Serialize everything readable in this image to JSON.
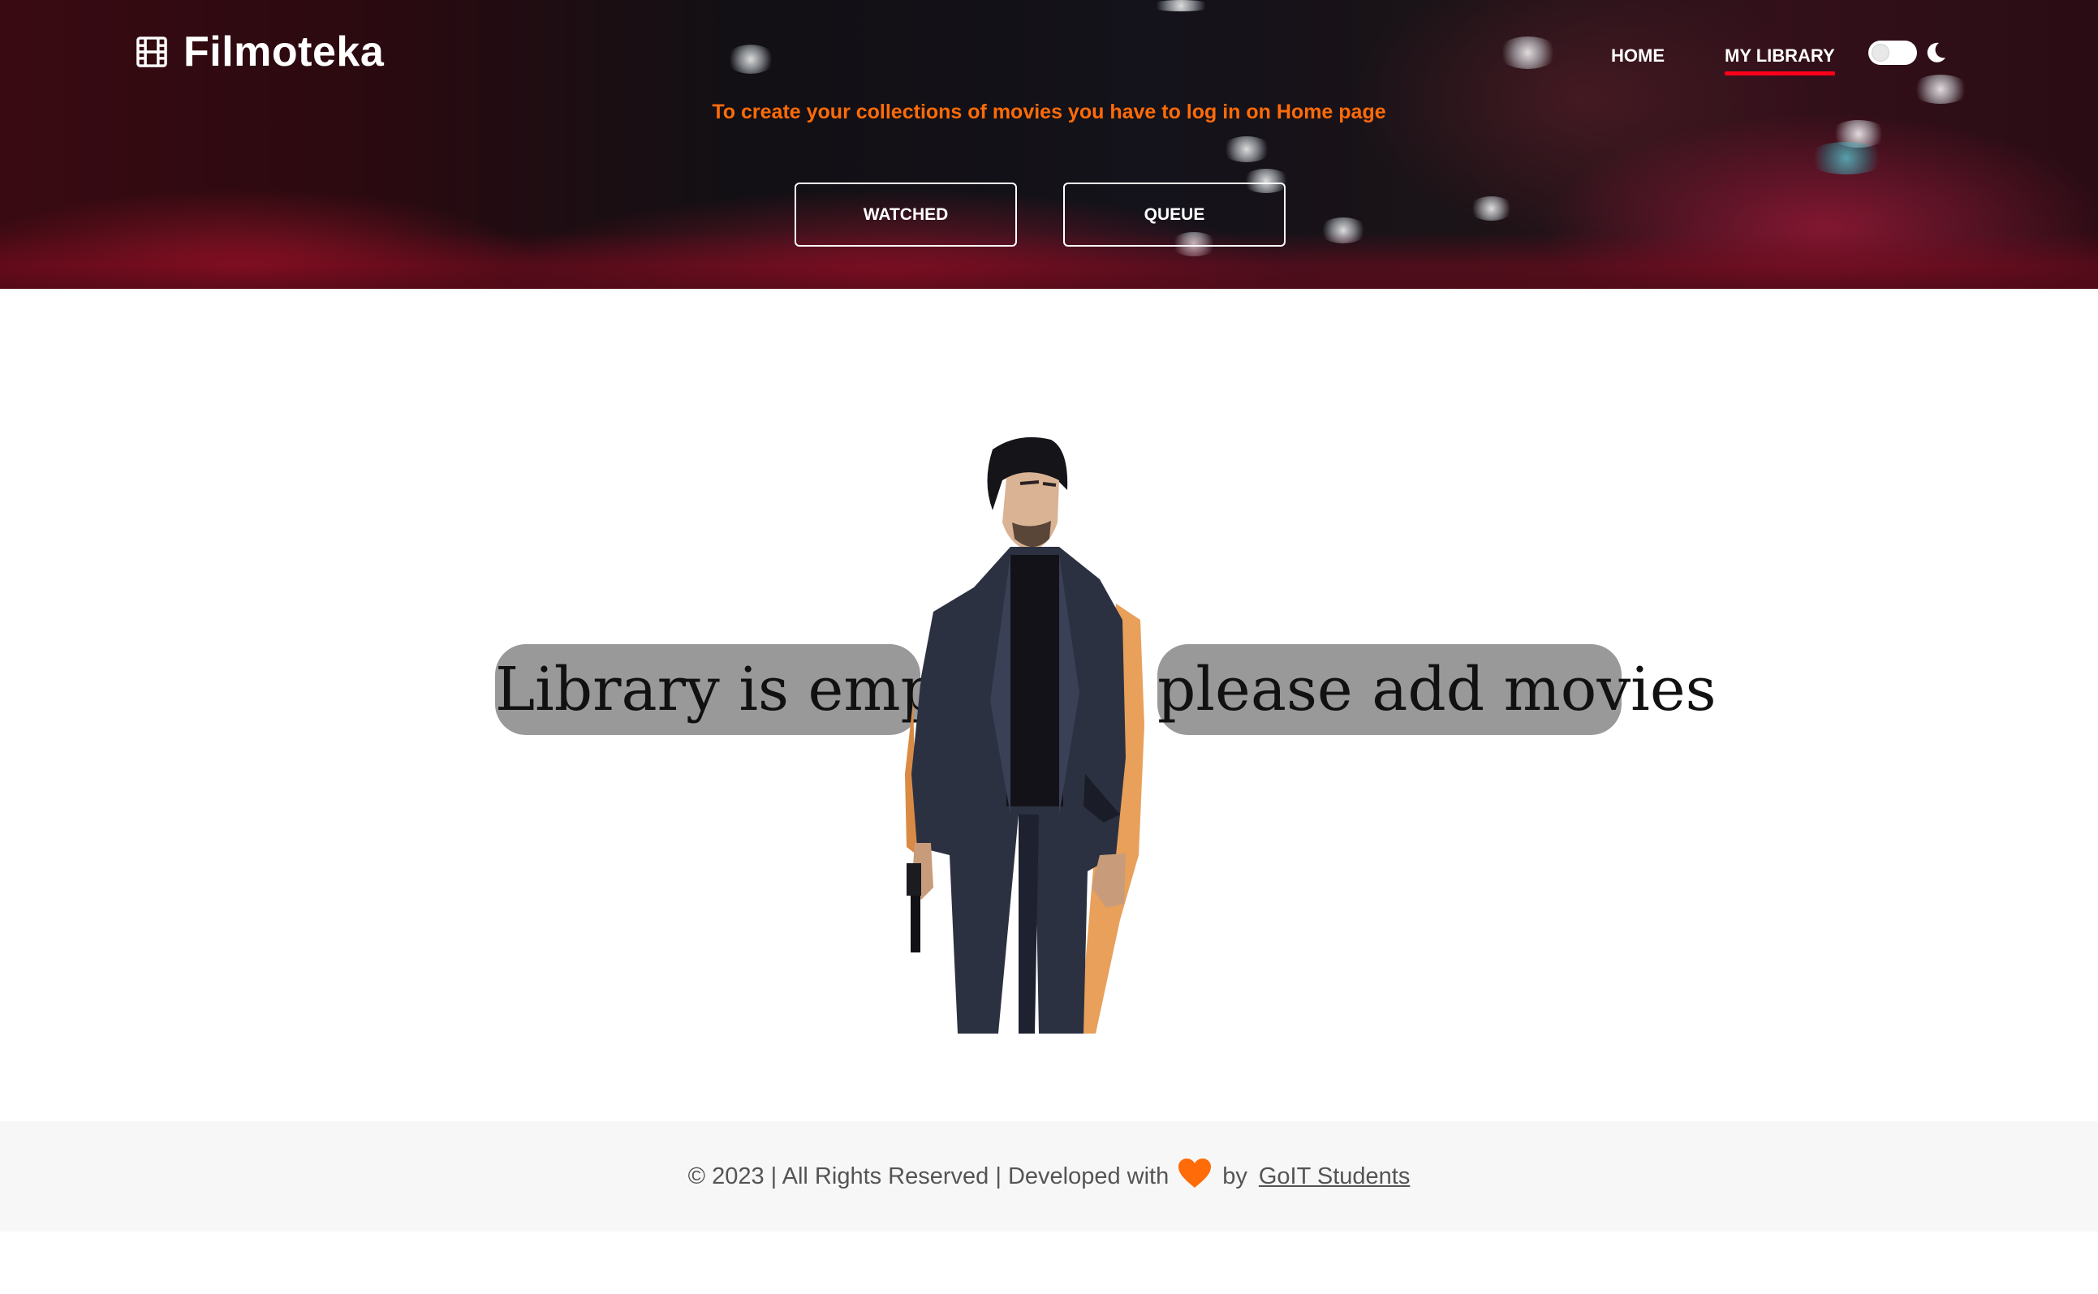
{
  "header": {
    "logo_text": "Filmoteka",
    "nav": {
      "home": "HOME",
      "library": "MY LIBRARY"
    },
    "login_message": "To create your collections of movies you have to log in on Home page",
    "buttons": {
      "watched": "WATCHED",
      "queue": "QUEUE"
    },
    "theme": "light"
  },
  "main": {
    "empty_left": "Library is empty",
    "empty_right": "please add movies"
  },
  "footer": {
    "text": "© 2023 | All Rights Reserved | Developed with",
    "by": "by",
    "link": "GoIT Students"
  },
  "colors": {
    "accent": "#ff6b08",
    "active_underline": "#ff001b",
    "pill_bg": "#999999"
  },
  "icons": [
    "film-icon",
    "moon-icon",
    "heart-icon"
  ]
}
